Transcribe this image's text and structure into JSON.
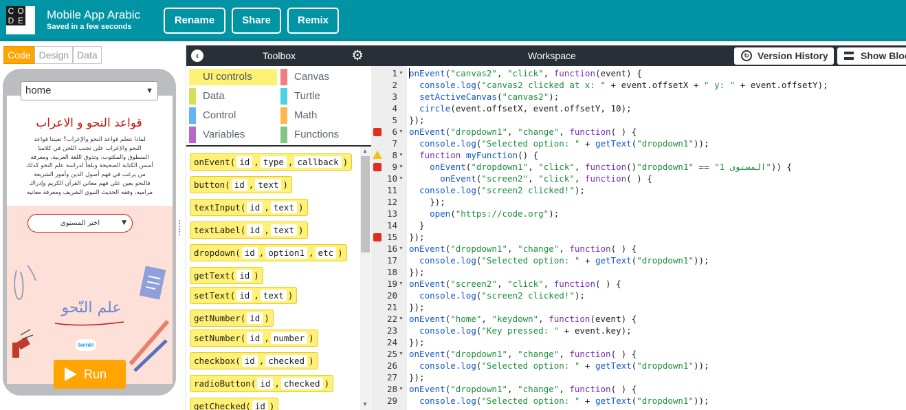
{
  "header": {
    "logo_letters": [
      "C",
      "O",
      "D",
      "E"
    ],
    "app_title": "Mobile App Arabic",
    "save_status": "Saved in a few seconds",
    "buttons": {
      "rename": "Rename",
      "share": "Share",
      "remix": "Remix"
    }
  },
  "left_panel": {
    "tabs": [
      "Code",
      "Design",
      "Data"
    ],
    "active_tab": "Code",
    "app_preview": {
      "screen_dropdown_value": "home",
      "arabic_title": "قواعد النحو و الاعراب",
      "arabic_body_lines": [
        "لماذا نتعلم قواعد النحو والإعراب؟ تعيننا قواعد",
        "النحو والإعراب على تجنب اللحن في كلامنا",
        "المنطوق والمكتوب، وتذوق اللغة العربية، ومعرفة",
        "أسس الكتابة الصحيحة وبلجأ لدراسة علم النحو كذلك",
        "من يرغب في فهم أصول الدين وأمور الشريعة",
        "فالنحو يعين على فهم معاني القرآن الكريم وإدراك",
        "مراميه، وفقه الحديث النبوي الشريف ومعرفة معانيه"
      ],
      "level_select_placeholder": "اختر المستوى",
      "image_text": "علم النّحو",
      "brand_badge": "twinkl"
    },
    "run_button": "Run"
  },
  "toolbox": {
    "title": "Toolbox",
    "categories": [
      {
        "label": "UI controls",
        "color": "#fff176",
        "selected": true
      },
      {
        "label": "Canvas",
        "color": "#f08080",
        "selected": false
      },
      {
        "label": "Data",
        "color": "#d4e157",
        "selected": false
      },
      {
        "label": "Turtle",
        "color": "#4dd0e1",
        "selected": false
      },
      {
        "label": "Control",
        "color": "#64b5f6",
        "selected": false
      },
      {
        "label": "Math",
        "color": "#ffb74d",
        "selected": false
      },
      {
        "label": "Variables",
        "color": "#ba68c8",
        "selected": false
      },
      {
        "label": "Functions",
        "color": "#81c784",
        "selected": false
      }
    ],
    "blocks": [
      {
        "name": "onEvent(",
        "params": [
          "id",
          "type",
          "callback"
        ]
      },
      {
        "name": "button(",
        "params": [
          "id",
          "text"
        ]
      },
      {
        "name": "textInput(",
        "params": [
          "id",
          "text"
        ]
      },
      {
        "name": "textLabel(",
        "params": [
          "id",
          "text"
        ]
      },
      {
        "name": "dropdown(",
        "params": [
          "id",
          "option1",
          "etc"
        ]
      },
      {
        "name": "getText(",
        "params": [
          "id"
        ]
      },
      {
        "name": "setText(",
        "params": [
          "id",
          "text"
        ]
      },
      {
        "name": "getNumber(",
        "params": [
          "id"
        ]
      },
      {
        "name": "setNumber(",
        "params": [
          "id",
          "number"
        ]
      },
      {
        "name": "checkbox(",
        "params": [
          "id",
          "checked"
        ]
      },
      {
        "name": "radioButton(",
        "params": [
          "id",
          "checked"
        ]
      },
      {
        "name": "getChecked(",
        "params": [
          "id"
        ]
      }
    ]
  },
  "workspace": {
    "title": "Workspace",
    "version_history": "Version History",
    "show_blocks": "Show Blocks",
    "lines": [
      {
        "n": 1,
        "fold": true,
        "marker": null,
        "code": "onEvent(\"canvas2\", \"click\", function(event) {"
      },
      {
        "n": 2,
        "fold": false,
        "marker": null,
        "code": "  console.log(\"canvas2 clicked at x: \" + event.offsetX + \" y: \" + event.offsetY);"
      },
      {
        "n": 3,
        "fold": false,
        "marker": null,
        "code": "  setActiveCanvas(\"canvas2\");"
      },
      {
        "n": 4,
        "fold": false,
        "marker": null,
        "code": "  circle(event.offsetX, event.offsetY, 10);"
      },
      {
        "n": 5,
        "fold": false,
        "marker": null,
        "code": "});"
      },
      {
        "n": 6,
        "fold": true,
        "marker": "error",
        "code": "onEvent(\"dropdown1\", \"change\", function( ) {"
      },
      {
        "n": 7,
        "fold": false,
        "marker": null,
        "code": "  console.log(\"Selected option: \" + getText(\"dropdown1\"));"
      },
      {
        "n": 8,
        "fold": true,
        "marker": "warning",
        "code": "  function myFunction() {"
      },
      {
        "n": 9,
        "fold": true,
        "marker": "error",
        "code": "    onEvent(\"dropdown1\", \"click\", function()\"dropdown1\" == \"1 المستوى\")) {"
      },
      {
        "n": 10,
        "fold": true,
        "marker": null,
        "code": "      onEvent(\"screen2\", \"click\", function( ) {"
      },
      {
        "n": 11,
        "fold": false,
        "marker": null,
        "code": "  console.log(\"screen2 clicked!\");"
      },
      {
        "n": 12,
        "fold": false,
        "marker": null,
        "code": "    });"
      },
      {
        "n": 13,
        "fold": false,
        "marker": null,
        "code": "    open(\"https://code.org\");"
      },
      {
        "n": 14,
        "fold": false,
        "marker": null,
        "code": "  }"
      },
      {
        "n": 15,
        "fold": false,
        "marker": "error",
        "code": "});"
      },
      {
        "n": 16,
        "fold": true,
        "marker": null,
        "code": "onEvent(\"dropdown1\", \"change\", function( ) {"
      },
      {
        "n": 17,
        "fold": false,
        "marker": null,
        "code": "  console.log(\"Selected option: \" + getText(\"dropdown1\"));"
      },
      {
        "n": 18,
        "fold": false,
        "marker": null,
        "code": "});"
      },
      {
        "n": 19,
        "fold": true,
        "marker": null,
        "code": "onEvent(\"screen2\", \"click\", function( ) {"
      },
      {
        "n": 20,
        "fold": false,
        "marker": null,
        "code": "  console.log(\"screen2 clicked!\");"
      },
      {
        "n": 21,
        "fold": false,
        "marker": null,
        "code": "});"
      },
      {
        "n": 22,
        "fold": true,
        "marker": null,
        "code": "onEvent(\"home\", \"keydown\", function(event) {"
      },
      {
        "n": 23,
        "fold": false,
        "marker": null,
        "code": "  console.log(\"Key pressed: \" + event.key);"
      },
      {
        "n": 24,
        "fold": false,
        "marker": null,
        "code": "});"
      },
      {
        "n": 25,
        "fold": true,
        "marker": null,
        "code": "onEvent(\"dropdown1\", \"change\", function( ) {"
      },
      {
        "n": 26,
        "fold": false,
        "marker": null,
        "code": "  console.log(\"Selected option: \" + getText(\"dropdown1\"));"
      },
      {
        "n": 27,
        "fold": false,
        "marker": null,
        "code": "});"
      },
      {
        "n": 28,
        "fold": true,
        "marker": null,
        "code": "onEvent(\"dropdown1\", \"change\", function( ) {"
      },
      {
        "n": 29,
        "fold": false,
        "marker": null,
        "code": "  console.log(\"Selected option: \" + getText(\"dropdown1\"));"
      }
    ]
  }
}
